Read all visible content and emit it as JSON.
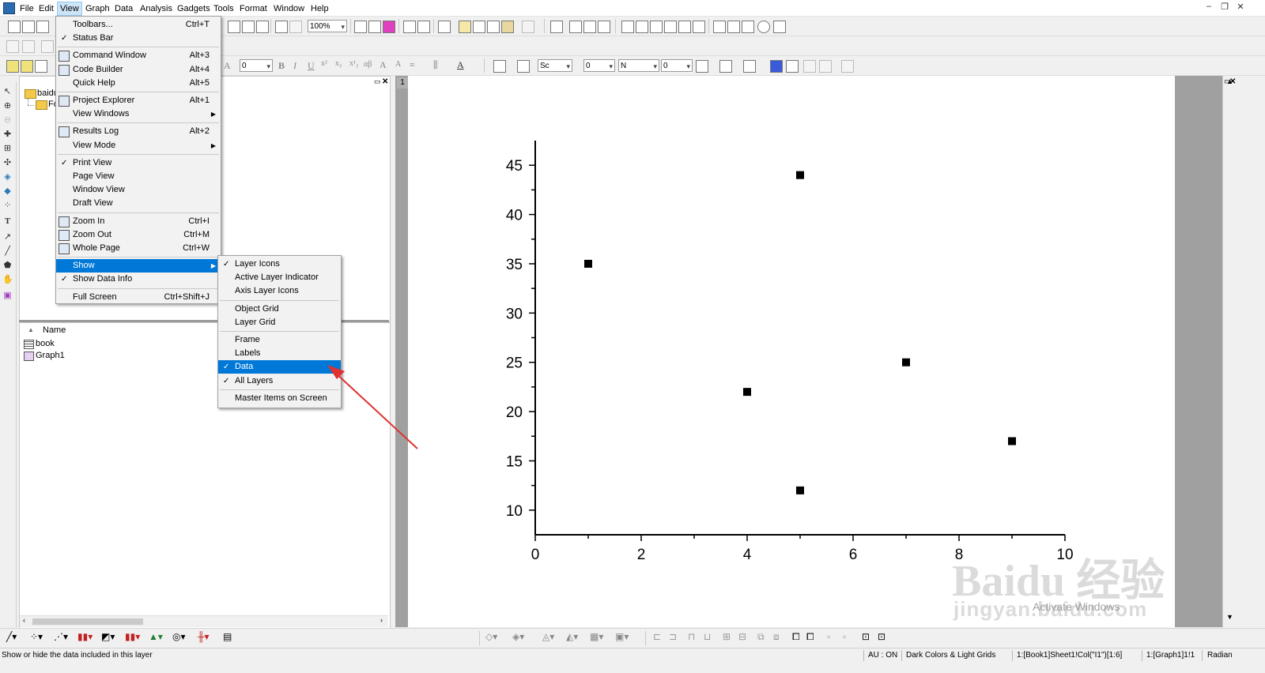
{
  "menubar": {
    "items": [
      "File",
      "Edit",
      "View",
      "Graph",
      "Data",
      "Analysis",
      "Gadgets",
      "Tools",
      "Format",
      "Window",
      "Help"
    ],
    "active": "View"
  },
  "toolbar": {
    "zoom_value": "100%",
    "font_size": "0",
    "line_style": "Sc",
    "fill_label": "N"
  },
  "view_menu": {
    "items": [
      {
        "label": "Toolbars...",
        "shortcut": "Ctrl+T"
      },
      {
        "label": "Status Bar",
        "checked": true
      },
      {
        "label": "Command Window",
        "shortcut": "Alt+3",
        "icon": "command-window-icon"
      },
      {
        "label": "Code Builder",
        "shortcut": "Alt+4",
        "icon": "code-builder-icon"
      },
      {
        "label": "Quick Help",
        "shortcut": "Alt+5"
      },
      {
        "label": "Project Explorer",
        "shortcut": "Alt+1",
        "icon": "project-explorer-icon"
      },
      {
        "label": "View Windows",
        "submenu": true
      },
      {
        "label": "Results Log",
        "shortcut": "Alt+2",
        "icon": "results-log-icon"
      },
      {
        "label": "View Mode",
        "submenu": true
      },
      {
        "label": "Print View",
        "checked": true
      },
      {
        "label": "Page View"
      },
      {
        "label": "Window View"
      },
      {
        "label": "Draft View"
      },
      {
        "label": "Zoom In",
        "shortcut": "Ctrl+I",
        "icon": "zoom-in-icon"
      },
      {
        "label": "Zoom Out",
        "shortcut": "Ctrl+M",
        "icon": "zoom-out-icon"
      },
      {
        "label": "Whole Page",
        "shortcut": "Ctrl+W",
        "icon": "whole-page-icon"
      },
      {
        "label": "Show",
        "submenu": true,
        "selected": true
      },
      {
        "label": "Show Data Info",
        "checked": true
      },
      {
        "label": "Full Screen",
        "shortcut": "Ctrl+Shift+J"
      }
    ]
  },
  "show_submenu": {
    "items": [
      {
        "label": "Layer Icons",
        "checked": true
      },
      {
        "label": "Active Layer Indicator"
      },
      {
        "label": "Axis Layer Icons"
      },
      {
        "label": "Object Grid"
      },
      {
        "label": "Layer Grid"
      },
      {
        "label": "Frame"
      },
      {
        "label": "Labels"
      },
      {
        "label": "Data",
        "checked": true,
        "selected": true
      },
      {
        "label": "All Layers",
        "checked": true
      },
      {
        "label": "Master Items on Screen"
      }
    ]
  },
  "project_explorer": {
    "folders": [
      "baidu",
      "Fo"
    ],
    "column_header": "Name",
    "items": [
      {
        "name": "book",
        "icon": "workbook-icon"
      },
      {
        "name": "Graph1",
        "icon": "graph-icon"
      }
    ]
  },
  "graph": {
    "layer_number": "1"
  },
  "chart_data": {
    "type": "scatter",
    "title": "",
    "xlabel": "",
    "ylabel": "",
    "x": [
      1,
      5,
      4,
      7,
      9,
      5
    ],
    "y": [
      35,
      44,
      22,
      25,
      17,
      12
    ],
    "xlim": [
      0,
      10
    ],
    "ylim": [
      7.5,
      47.5
    ],
    "xticks": [
      0,
      2,
      4,
      6,
      8,
      10
    ],
    "yticks": [
      10,
      15,
      20,
      25,
      30,
      35,
      40,
      45
    ],
    "grid": false,
    "marker": "square",
    "marker_color": "#000000"
  },
  "statusbar": {
    "hint": "Show or hide the data included in this layer",
    "au": "AU : ON",
    "theme": "Dark Colors & Light Grids",
    "cell": "1:[Book1]Sheet1!Col(\"I1\")[1:6]",
    "graph": "1:[Graph1]1!1",
    "angle": "Radian"
  },
  "overlay": {
    "activate_windows": "Activate Windows",
    "watermark": "Baidu 经验",
    "watermark_url": "jingyan.baidu.com"
  },
  "colors": {
    "menu_highlight": "#0078d7",
    "arrow": "#e03030",
    "menubar_active": "#cce4f7"
  }
}
